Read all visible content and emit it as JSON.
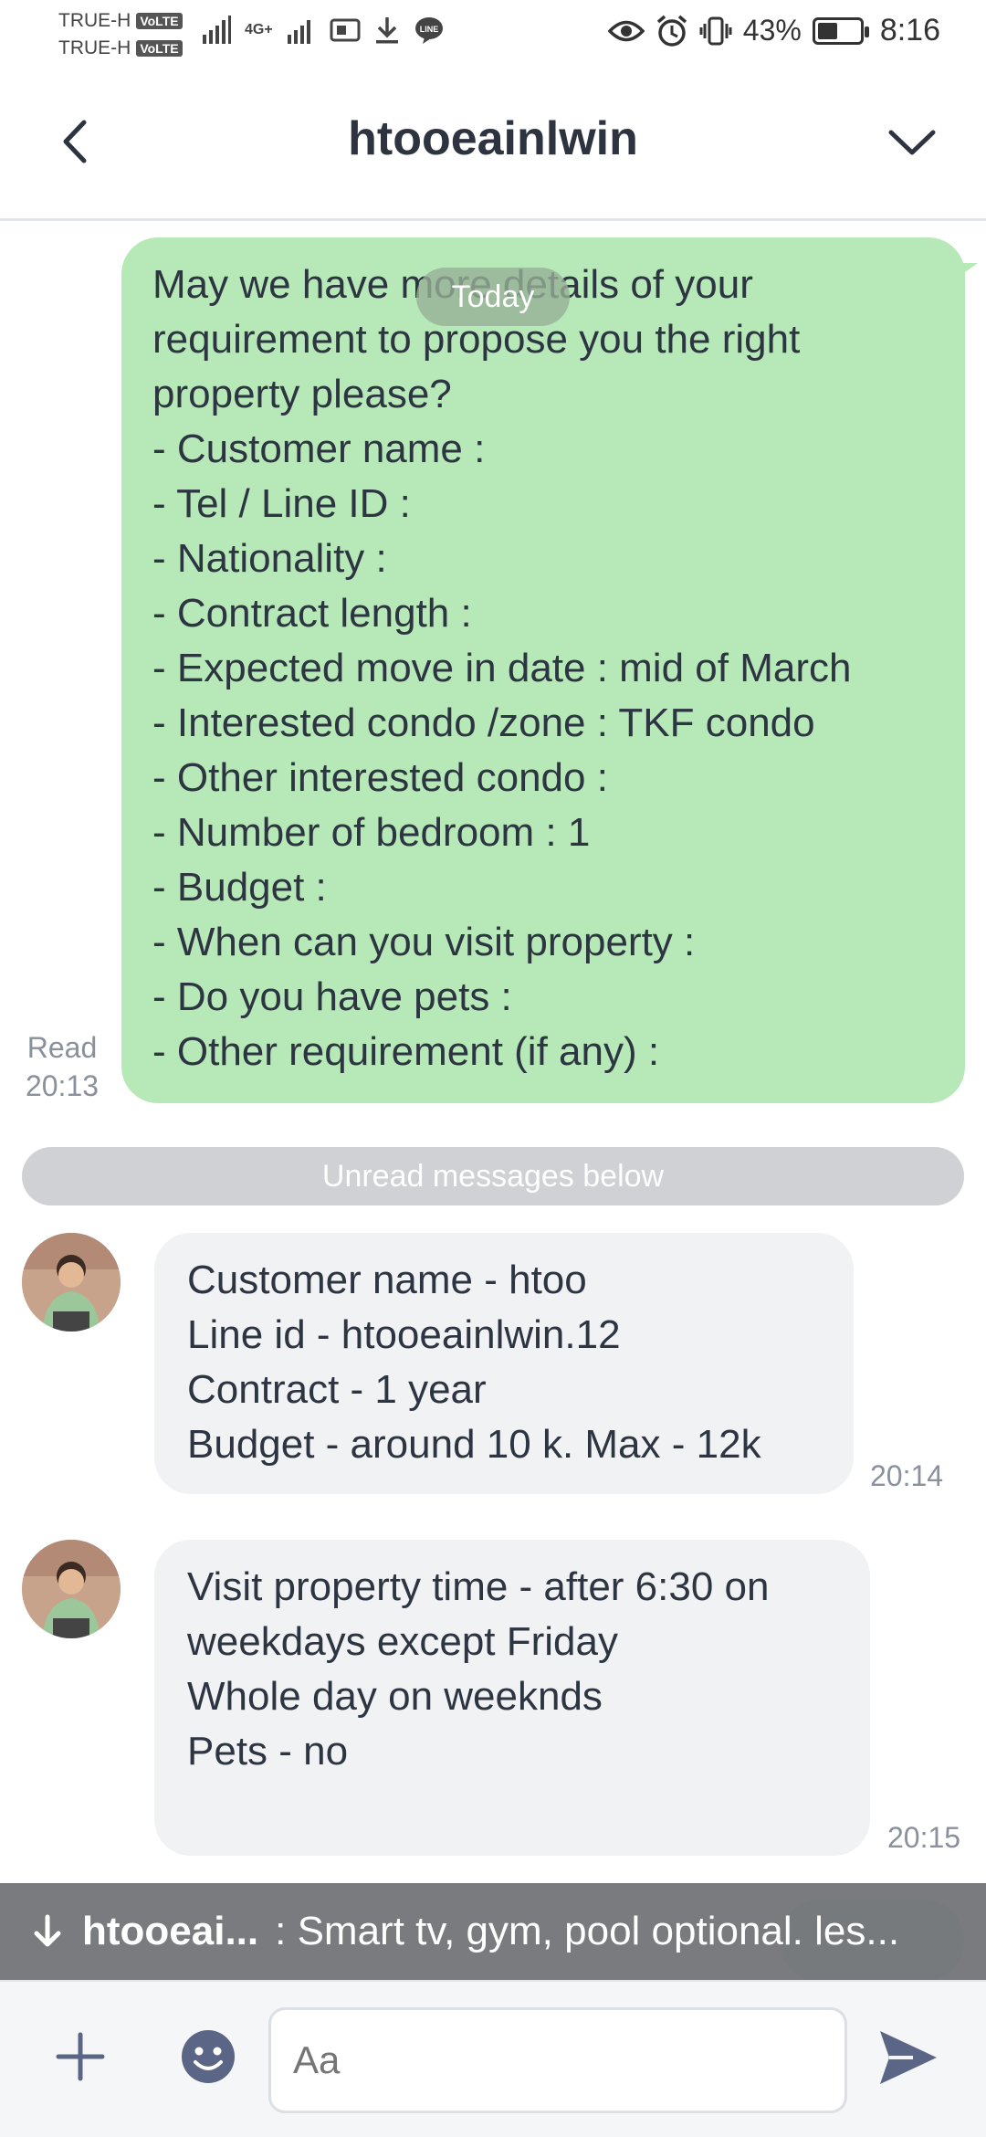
{
  "status_bar": {
    "carrier1": "TRUE-H",
    "carrier2": "TRUE-H",
    "volte": "VoLTE",
    "network": "4G+",
    "battery": "43%",
    "time": "8:16",
    "icons": [
      "signal-icon",
      "sim-icon",
      "download-icon",
      "line-app-icon",
      "eye-icon",
      "alarm-icon",
      "vibrate-icon",
      "battery-icon"
    ]
  },
  "header": {
    "title": "htooeainlwin"
  },
  "messages": {
    "today_label": "Today",
    "outgoing": {
      "text": "May we have more details of your requirement to propose you the right property please?\n- Customer name :\n- Tel / Line ID :\n- Nationality :\n- Contract length :\n- Expected move in date : mid of March\n- Interested condo /zone : TKF condo\n- Other interested condo :\n- Number of bedroom  : 1\n- Budget :\n- When can you visit property :\n- Do you have pets :\n- Other requirement (if any) :",
      "read_label": "Read",
      "time": "20:13"
    },
    "unread_label": "Unread messages below",
    "incoming": [
      {
        "lines": [
          "Customer name - htoo",
          "Line id - htooeainlwin.12",
          "Contract - 1 year",
          "Budget - around 10 k.  Max - 12k"
        ],
        "time": "20:14"
      },
      {
        "lines": [
          "Visit property time - after 6:30 on",
          "weekdays except Friday",
          "Whole day on weeknds",
          "Pets - no",
          ""
        ],
        "time": "20:15"
      }
    ]
  },
  "notification": {
    "sender": "htooeai...",
    "preview": ": Smart tv, gym, pool optional. les..."
  },
  "composer": {
    "placeholder": "Aa"
  },
  "colors": {
    "outgoing_bubble": "#b7e8b7",
    "incoming_bubble": "#f1f2f4",
    "icon_accent": "#5b6585"
  }
}
